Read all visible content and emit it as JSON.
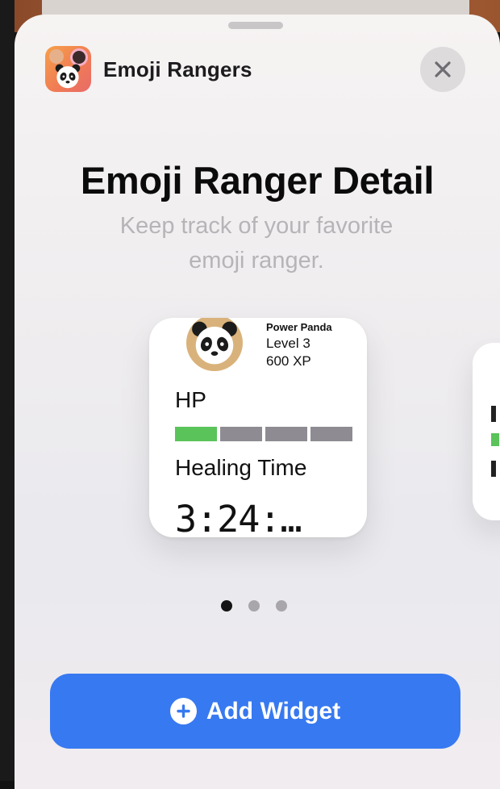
{
  "app": {
    "name": "Emoji Rangers",
    "icon": "panda-app-icon"
  },
  "close_icon": "close-icon",
  "widget_info": {
    "title": "Emoji Ranger Detail",
    "description_line1": "Keep track of your favorite",
    "description_line2": "emoji ranger."
  },
  "widget_preview": {
    "hero_name": "Power Panda",
    "level": "Level 3",
    "xp": "600 XP",
    "hp_label": "HP",
    "hp_filled_segments": 1,
    "hp_total_segments": 4,
    "hp_filled_color": "#5AC35A",
    "hp_empty_color": "#8E8C92",
    "healing_label": "Healing Time",
    "healing_time": "3:24:…"
  },
  "pager": {
    "count": 3,
    "active_index": 0
  },
  "add_button": {
    "label": "Add Widget",
    "icon": "plus-circle-icon",
    "color": "#3779F0"
  }
}
